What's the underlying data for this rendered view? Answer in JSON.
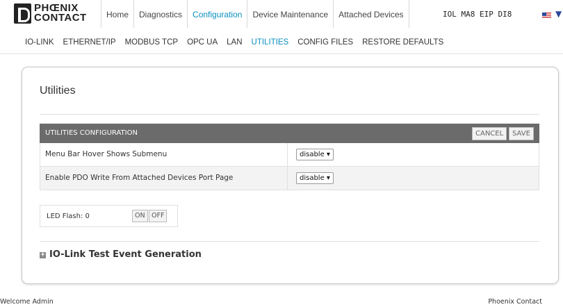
{
  "logo": {
    "line1": "PHŒNIX",
    "line2": "CONTACT"
  },
  "nav_tabs": [
    {
      "label": "Home"
    },
    {
      "label": "Diagnostics"
    },
    {
      "label": "Configuration"
    },
    {
      "label": "Device Maintenance"
    },
    {
      "label": "Attached Devices"
    }
  ],
  "active_tab": "Configuration",
  "device_name": "IOL MA8 EIP DI8",
  "sub_tabs": [
    {
      "label": "IO-LINK"
    },
    {
      "label": "ETHERNET/IP"
    },
    {
      "label": "MODBUS TCP"
    },
    {
      "label": "OPC UA"
    },
    {
      "label": "LAN"
    },
    {
      "label": "UTILITIES"
    },
    {
      "label": "CONFIG FILES"
    },
    {
      "label": "RESTORE DEFAULTS"
    }
  ],
  "active_sub_tab": "UTILITIES",
  "page_title": "Utilities",
  "config_table": {
    "header": "UTILITIES CONFIGURATION",
    "cancel_label": "CANCEL",
    "save_label": "SAVE",
    "rows": [
      {
        "label": "Menu Bar Hover Shows Submenu",
        "value": "disable ▾"
      },
      {
        "label": "Enable PDO Write From Attached Devices Port Page",
        "value": "disable ▾"
      }
    ]
  },
  "led": {
    "label": "LED Flash: 0",
    "on_label": "ON",
    "off_label": "OFF"
  },
  "iolink_section": {
    "icon": "+",
    "label": "IO-Link Test Event Generation"
  },
  "footer": {
    "left": "Welcome Admin",
    "right": "Phoenix Contact"
  },
  "colors": {
    "accent": "#0a8fbf",
    "table_header": "#6b6b6b"
  }
}
